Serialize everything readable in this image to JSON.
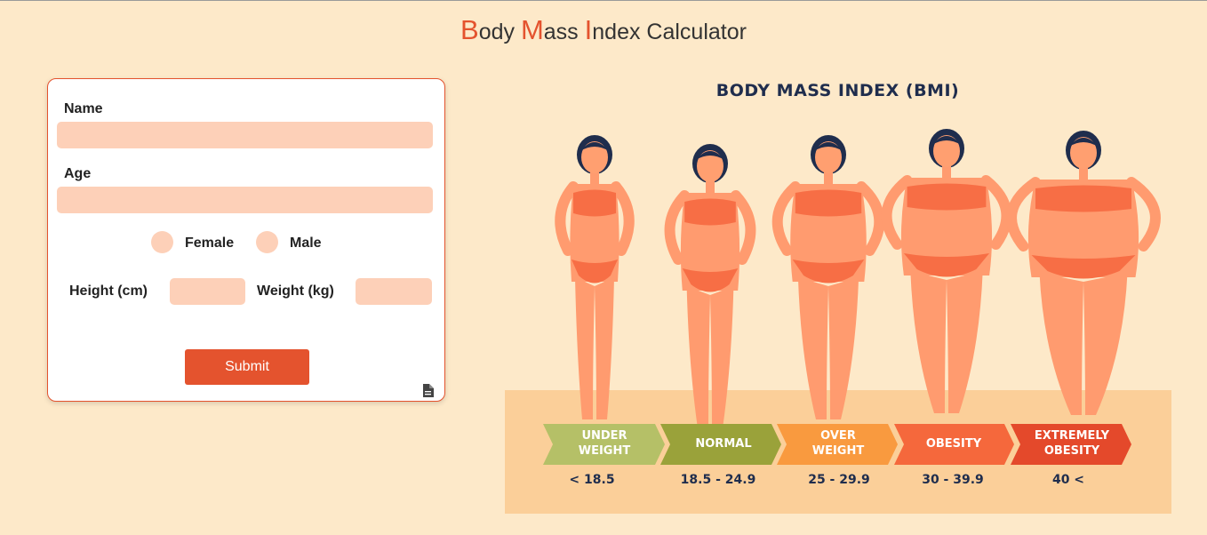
{
  "title": {
    "b": "B",
    "ody": "ody ",
    "m": "M",
    "ass": "ass ",
    "i": "I",
    "ndex": "ndex Calculator"
  },
  "form": {
    "name_label": "Name",
    "name_value": "",
    "age_label": "Age",
    "age_value": "",
    "gender_options": [
      "Female",
      "Male"
    ],
    "height_label": "Height (cm)",
    "height_value": "",
    "weight_label": "Weight (kg)",
    "weight_value": "",
    "submit_label": "Submit"
  },
  "infographic": {
    "title": "BODY MASS INDEX (BMI)",
    "categories": [
      {
        "line1": "UNDER",
        "line2": "WEIGHT",
        "range": "< 18.5",
        "color": "#b5c067"
      },
      {
        "line1": "NORMAL",
        "line2": "",
        "range": "18.5 - 24.9",
        "color": "#9aa23a"
      },
      {
        "line1": "OVER",
        "line2": "WEIGHT",
        "range": "25 - 29.9",
        "color": "#f99a3f"
      },
      {
        "line1": "OBESITY",
        "line2": "",
        "range": "30 - 39.9",
        "color": "#f5683c"
      },
      {
        "line1": "EXTREMELY",
        "line2": "OBESITY",
        "range": "40 <",
        "color": "#e4492b"
      }
    ]
  },
  "colors": {
    "background": "#fde9c9",
    "accent": "#e4532e",
    "field": "#fdd0b8",
    "skin": "#ff9b6f",
    "swimsuit": "#f76e45",
    "hair": "#1f2d4d"
  }
}
